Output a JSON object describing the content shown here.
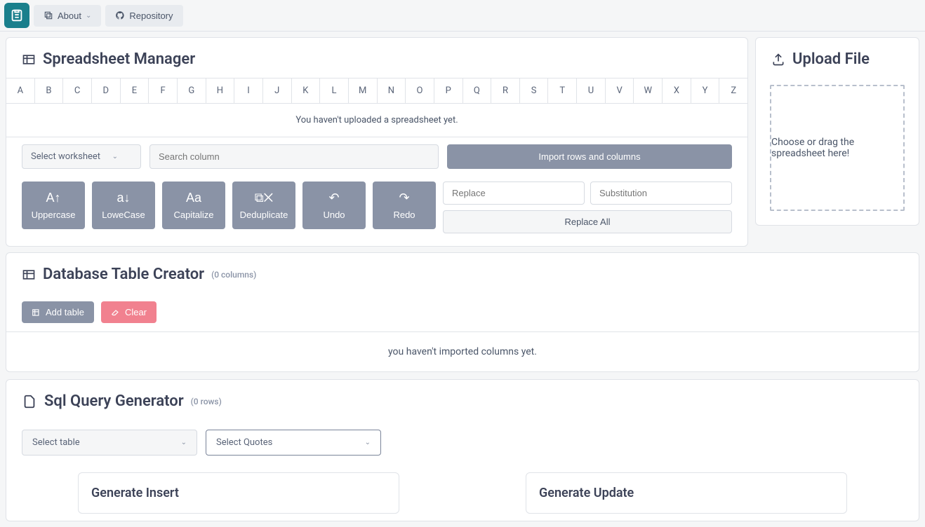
{
  "nav": {
    "about": "About",
    "repository": "Repository"
  },
  "spreadsheet": {
    "title": "Spreadsheet Manager",
    "columns": [
      "A",
      "B",
      "C",
      "D",
      "E",
      "F",
      "G",
      "H",
      "I",
      "J",
      "K",
      "L",
      "M",
      "N",
      "O",
      "P",
      "Q",
      "R",
      "S",
      "T",
      "U",
      "V",
      "W",
      "X",
      "Y",
      "Z"
    ],
    "empty": "You haven't uploaded a spreadsheet yet.",
    "worksheet_placeholder": "Select worksheet",
    "search_placeholder": "Search column",
    "import": "Import rows and columns",
    "uppercase": "Uppercase",
    "lowercase": "LoweCase",
    "capitalize": "Capitalize",
    "deduplicate": "Deduplicate",
    "undo": "Undo",
    "redo": "Redo",
    "replace_placeholder": "Replace",
    "substitution_placeholder": "Substitution",
    "replace_all": "Replace All"
  },
  "upload": {
    "title": "Upload File",
    "hint": "Choose or drag the spreadsheet here!"
  },
  "db": {
    "title": "Database Table Creator",
    "count": "(0 columns)",
    "add": "Add table",
    "clear": "Clear",
    "empty": "you haven't imported columns yet."
  },
  "sql": {
    "title": "Sql Query Generator",
    "count": "(0 rows)",
    "select_table": "Select table",
    "select_quotes": "Select Quotes",
    "gen_insert": "Generate Insert",
    "gen_update": "Generate Update"
  }
}
